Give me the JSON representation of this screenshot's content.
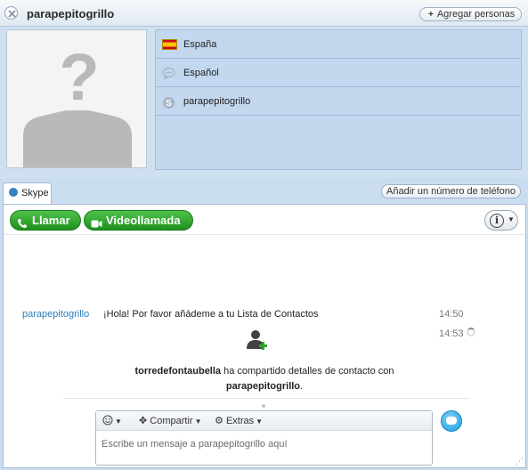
{
  "header": {
    "title": "parapepitogrillo",
    "add_people_label": "Agregar personas",
    "close_icon": "close-icon"
  },
  "profile": {
    "details": [
      {
        "icon": "spain-flag-icon",
        "label": "España"
      },
      {
        "icon": "speech-bubble-icon",
        "label": "Español"
      },
      {
        "icon": "skype-icon",
        "label": "parapepitogrillo"
      }
    ]
  },
  "tabs": {
    "skype_label": "Skype",
    "add_phone_label": "Añadir un número de teléfono"
  },
  "callbar": {
    "call_label": "Llamar",
    "video_label": "Videollamada"
  },
  "chat": {
    "sender": "parapepitogrillo",
    "message": "¡Hola! Por favor añádeme a tu Lista de Contactos",
    "time1": "14:50",
    "time2": "14:53",
    "share_user": "torredefontaubella",
    "share_text": " ha compartido detalles de contacto con ",
    "share_target": "parapepitogrillo",
    "share_end": "."
  },
  "compose": {
    "share_label": "Compartir",
    "extras_label": "Extras",
    "placeholder": "Escribe un mensaje a parapepitogrillo aquí"
  },
  "colors": {
    "accent_green": "#1f8f1d",
    "link_blue": "#2c7fb8",
    "panel_blue": "#c3d7ee"
  }
}
